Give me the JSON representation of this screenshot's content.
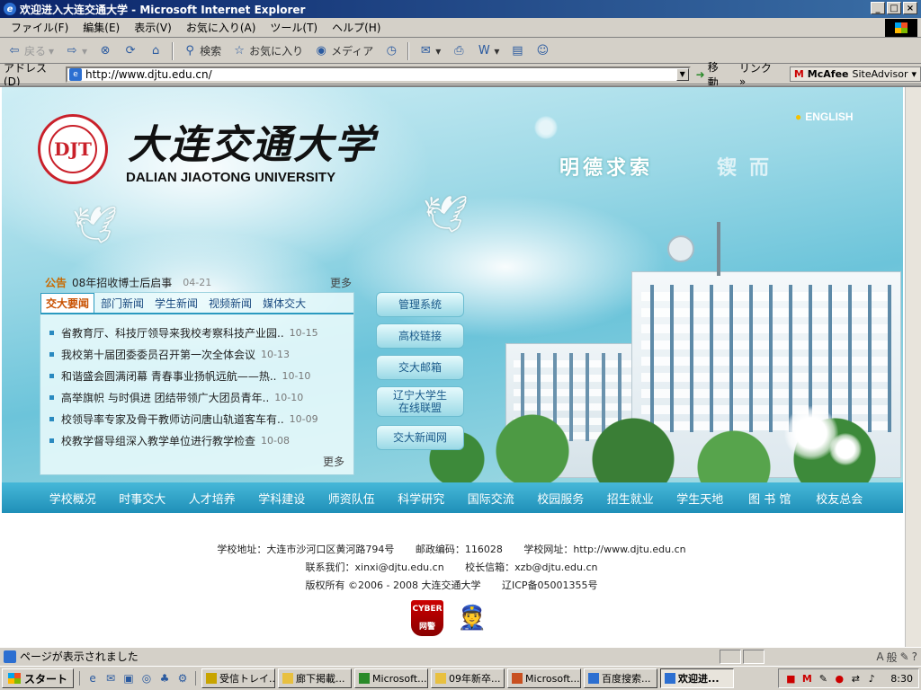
{
  "window": {
    "title": "欢迎进入大连交通大学 - Microsoft Internet Explorer",
    "controls": [
      "_",
      "□",
      "×"
    ]
  },
  "menu": [
    "ファイル(F)",
    "編集(E)",
    "表示(V)",
    "お気に入り(A)",
    "ツール(T)",
    "ヘルプ(H)"
  ],
  "toolbar": {
    "back": "戻る",
    "search": "検索",
    "favorites": "お気に入り",
    "media": "メディア"
  },
  "address": {
    "label": "アドレス(D)",
    "url": "http://www.djtu.edu.cn/",
    "go": "移動",
    "links": "リンク",
    "mcafee": "SiteAdvisor",
    "mcafee_brand": "McAfee"
  },
  "site": {
    "english": "ENGLISH",
    "logo_cn": "大连交通大学",
    "logo_en": "DALIAN JIAOTONG UNIVERSITY",
    "seal": "DJT",
    "motto": "明德求索",
    "motto2": "锲而"
  },
  "notice": {
    "tag": "公告",
    "text": "08年招收博士后启事",
    "date": "04-21",
    "more": "更多"
  },
  "news": {
    "tabs": [
      "交大要闻",
      "部门新闻",
      "学生新闻",
      "视频新闻",
      "媒体交大"
    ],
    "items": [
      {
        "title": "省教育厅、科技厅领导来我校考察科技产业园..",
        "date": "10-15"
      },
      {
        "title": "我校第十届团委委员召开第一次全体会议",
        "date": "10-13"
      },
      {
        "title": "和谐盛会圆满闭幕 青春事业扬帆远航——热..",
        "date": "10-10"
      },
      {
        "title": "高举旗帜 与时俱进 团结带领广大团员青年..",
        "date": "10-10"
      },
      {
        "title": "校领导率专家及骨干教师访问唐山轨道客车有..",
        "date": "10-09"
      },
      {
        "title": "校教学督导组深入教学单位进行教学检查",
        "date": "10-08"
      }
    ],
    "more": "更多"
  },
  "quick_links": [
    "管理系统",
    "高校链接",
    "交大邮箱",
    "辽宁大学生\n在线联盟",
    "交大新闻网"
  ],
  "nav": [
    "学校概况",
    "时事交大",
    "人才培养",
    "学科建设",
    "师资队伍",
    "科学研究",
    "国际交流",
    "校园服务",
    "招生就业",
    "学生天地",
    "图 书 馆",
    "校友总会"
  ],
  "footer": {
    "address": "学校地址：大连市沙河口区黄河路794号",
    "postcode": "邮政编码：116028",
    "website": "学校网址：http://www.djtu.edu.cn",
    "contact": "联系我们：xinxi@djtu.edu.cn",
    "president_mail": "校长信箱：xzb@djtu.edu.cn",
    "copyright": "版权所有 ©2006 - 2008 大连交通大学",
    "icp": "辽ICP备05001355号",
    "badge_cyber": "CYBER",
    "badge_cyber_cn": "网警"
  },
  "status": {
    "text": "ページが表示されました"
  },
  "taskbar": {
    "start": "スタート",
    "tasks": [
      "受信トレイ...",
      "廊下掲載...",
      "Microsoft...",
      "09年新卒...",
      "Microsoft...",
      "百度搜索...",
      "欢迎进..."
    ],
    "clock": "8:30"
  }
}
